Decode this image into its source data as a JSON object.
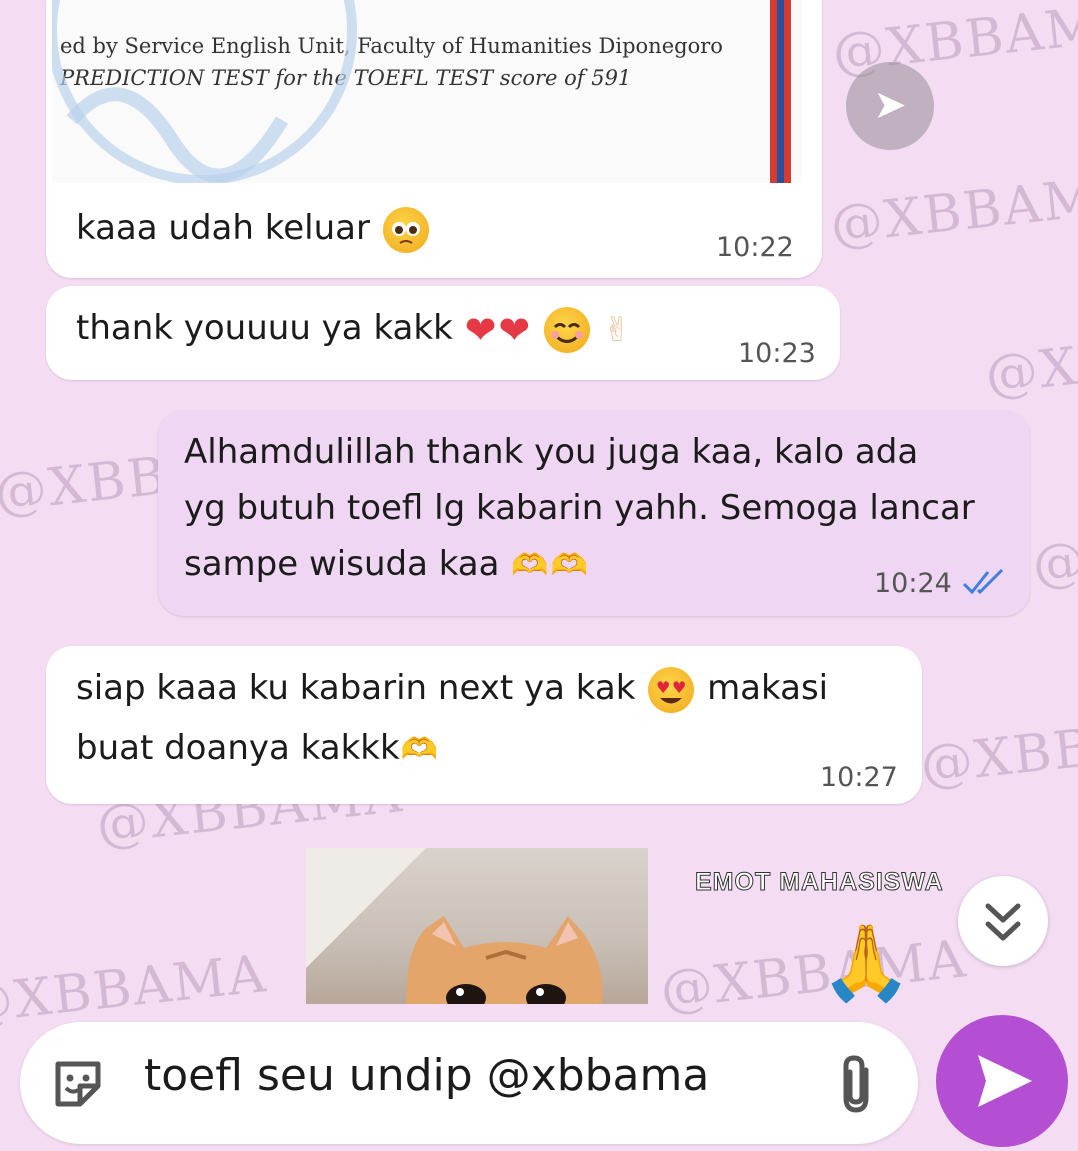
{
  "watermark": "@XBBAMA",
  "certificate": {
    "line1": "ed by Service English Unit, Faculty of Humanities Diponegoro",
    "line2": "PREDICTION TEST for the TOEFL TEST score of 591"
  },
  "messages": [
    {
      "text": "kaaa udah keluar",
      "time": "10:22"
    },
    {
      "text": "thank youuuu ya kakk",
      "time": "10:23"
    },
    {
      "text_line1": "Alhamdulillah thank you juga kaa, kalo ada",
      "text_line2": "yg butuh toefl lg kabarin yahh. Semoga lancar",
      "text_line3": "sampe wisuda kaa",
      "time": "10:24"
    },
    {
      "text_line1": "siap kaaa ku kabarin next ya kak",
      "text_line1b": "makasi",
      "text_line2": "buat doanya kakkk",
      "time": "10:27"
    }
  ],
  "sticker_caption": "EMOT MAHASISWA",
  "composer": {
    "value": "toefl seu undip @xbbama",
    "icons": [
      "sticker-icon",
      "attach-icon",
      "send-icon"
    ]
  },
  "colors": {
    "background": "#f4dcf3",
    "outgoing_bubble": "#efd6f2",
    "incoming_bubble": "#ffffff",
    "send_button": "#b44fd4",
    "read_ticks": "#3f7fe0"
  }
}
